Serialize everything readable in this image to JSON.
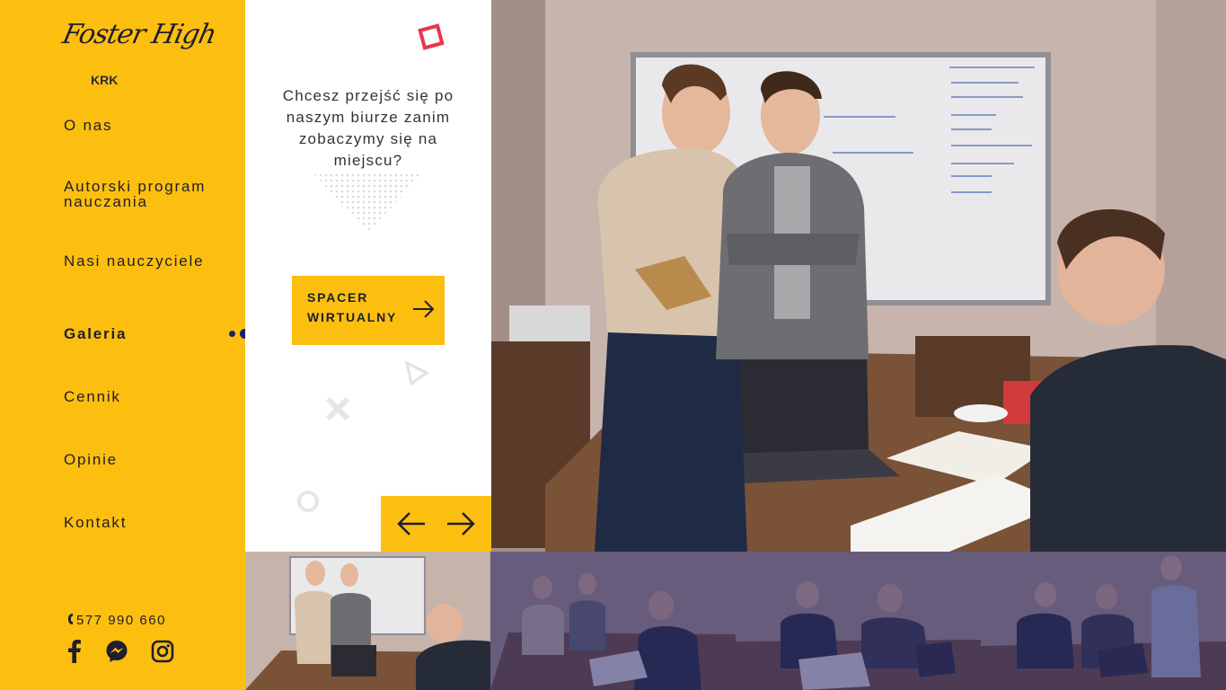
{
  "logo": {
    "script": "Foster High",
    "sub": "KRK"
  },
  "nav": [
    {
      "label": "O nas",
      "active": false
    },
    {
      "label": "Autorski program nauczania",
      "active": false
    },
    {
      "label": "Nasi nauczyciele",
      "active": false
    },
    {
      "label": "Galeria",
      "active": true
    },
    {
      "label": "Cennik",
      "active": false
    },
    {
      "label": "Opinie",
      "active": false
    },
    {
      "label": "Kontakt",
      "active": false
    }
  ],
  "contact": {
    "phone": "577 990 660"
  },
  "social": [
    "facebook-icon",
    "messenger-icon",
    "instagram-icon"
  ],
  "panel": {
    "text": "Chcesz przejść się po naszym biurze zanim zobaczymy się na miejscu?",
    "cta": "SPACER WIRTUALNY"
  },
  "gallery": {
    "thumbnail_count": 4,
    "active_thumbnail": 0
  },
  "colors": {
    "accent": "#fdbf0f",
    "navy": "#1b2170",
    "text": "#1e1e2e"
  }
}
